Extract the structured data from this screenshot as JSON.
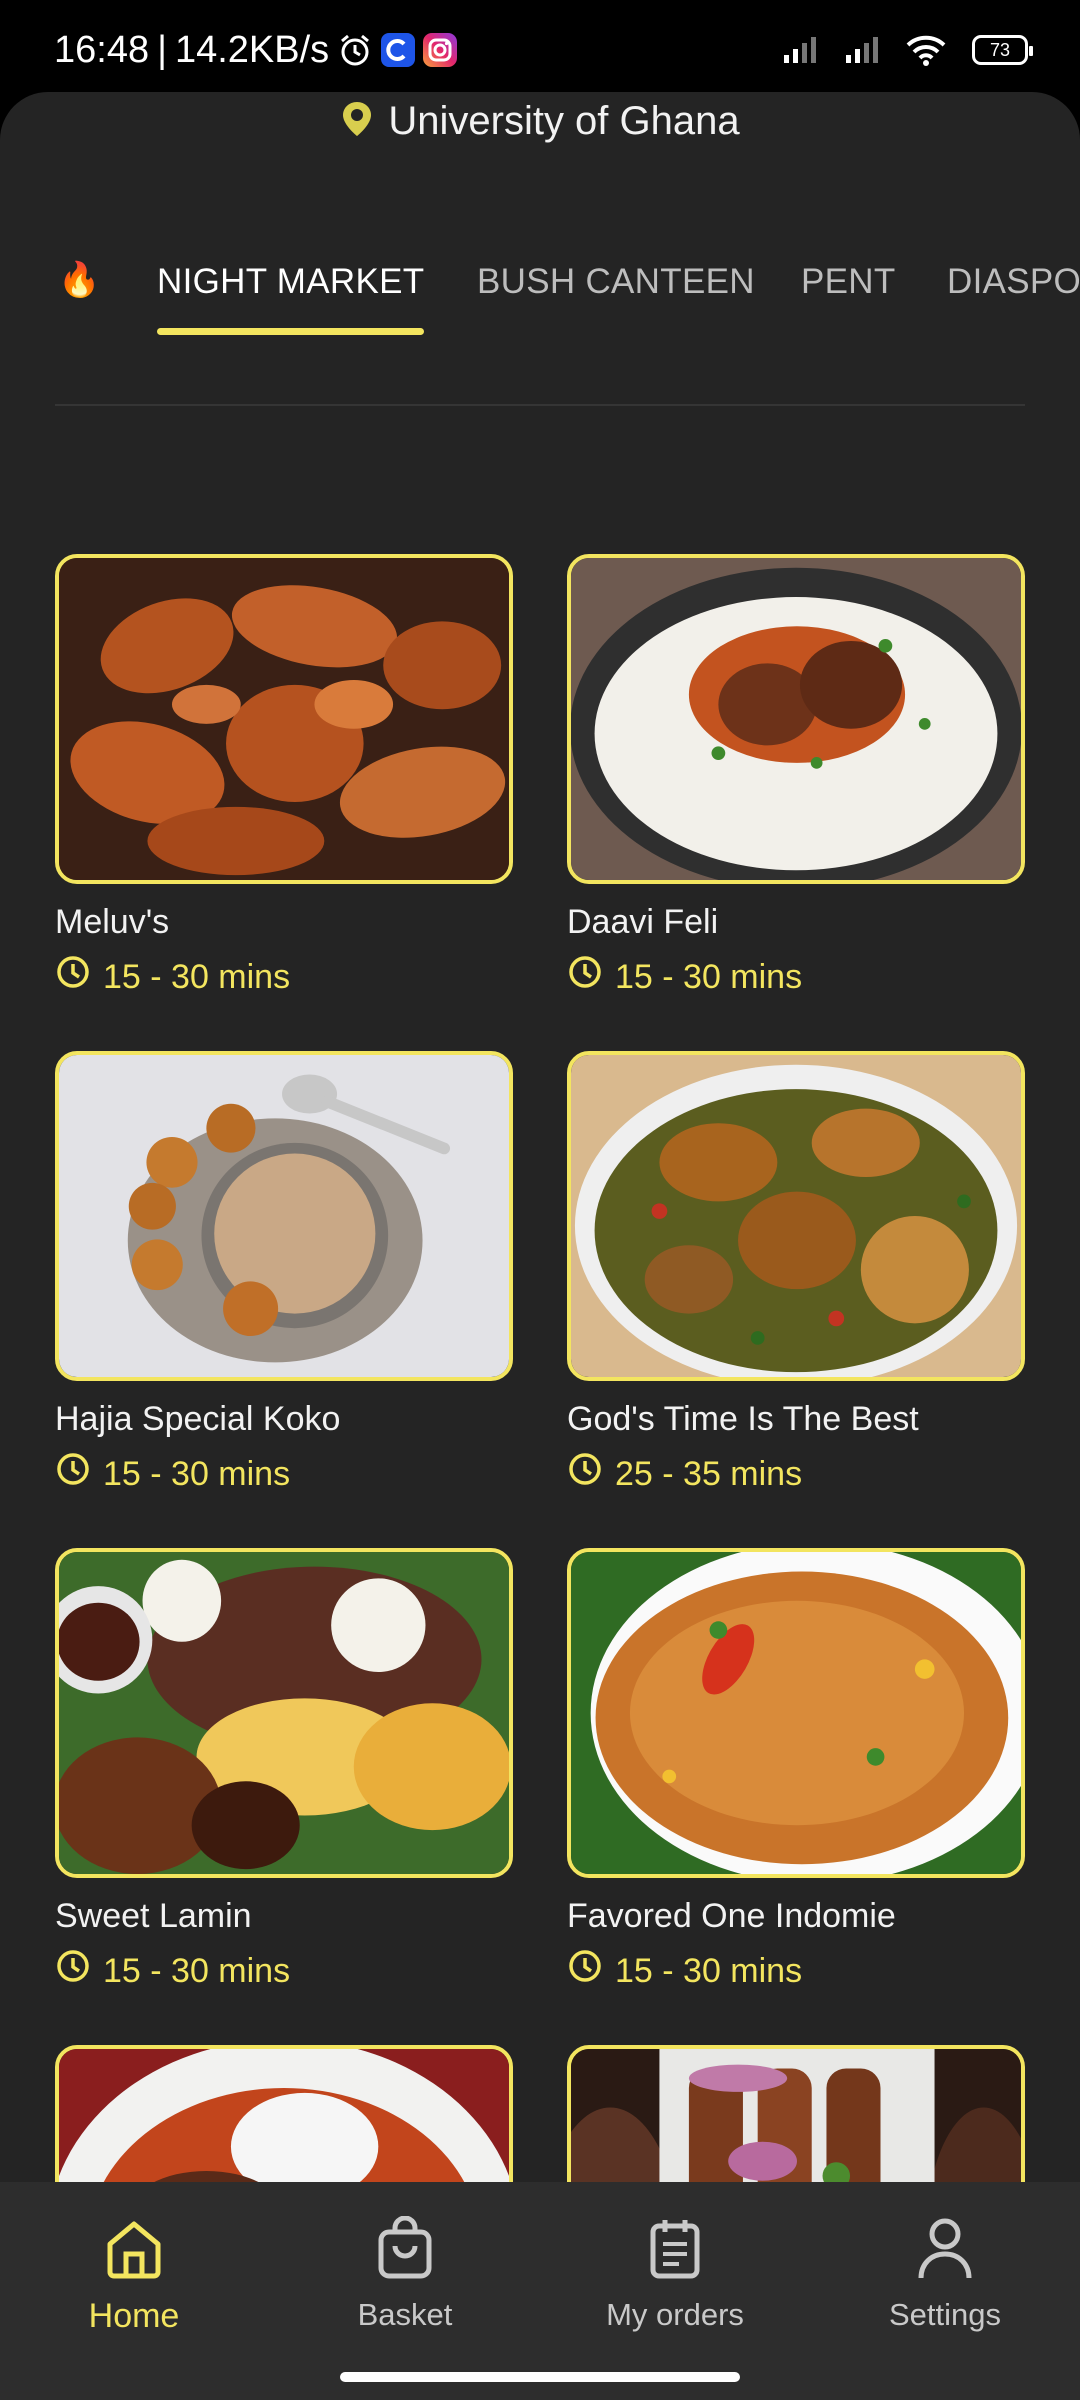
{
  "status_bar": {
    "time": "16:48",
    "separator": "|",
    "speed": "14.2KB/s",
    "battery": "73",
    "icons": [
      "alarm-icon",
      "c-app-icon",
      "instagram-icon",
      "signal-icon",
      "signal-icon",
      "wifi-icon",
      "battery-icon"
    ]
  },
  "location": {
    "label": "University of Ghana",
    "icon": "location-pin-icon"
  },
  "tabs": [
    {
      "label": "NIGHT MARKET",
      "active": true
    },
    {
      "label": "BUSH CANTEEN",
      "active": false
    },
    {
      "label": "PENT",
      "active": false
    },
    {
      "label": "DIASPORA",
      "active": false
    }
  ],
  "fire_tab_icon": "🔥",
  "restaurants": [
    {
      "name": "Meluv's",
      "time": "15 - 30 mins"
    },
    {
      "name": "Daavi Feli",
      "time": "15 - 30 mins"
    },
    {
      "name": "Hajia Special Koko",
      "time": "15 - 30 mins"
    },
    {
      "name": "God's Time Is The Best",
      "time": "25 - 35 mins"
    },
    {
      "name": "Sweet Lamin",
      "time": "15 - 30 mins"
    },
    {
      "name": "Favored One Indomie",
      "time": "15 - 30 mins"
    },
    {
      "name": "",
      "time": ""
    },
    {
      "name": "",
      "time": ""
    }
  ],
  "bottom_nav": [
    {
      "label": "Home",
      "icon": "home-icon",
      "active": true
    },
    {
      "label": "Basket",
      "icon": "basket-icon",
      "active": false
    },
    {
      "label": "My orders",
      "icon": "orders-clipboard-icon",
      "active": false
    },
    {
      "label": "Settings",
      "icon": "profile-icon",
      "active": false
    }
  ],
  "colors": {
    "accent": "#f3e55f",
    "background": "#242424",
    "nav_background": "#2d2d2d",
    "text": "#f2f2f2",
    "muted_text": "#bdbdbd"
  }
}
